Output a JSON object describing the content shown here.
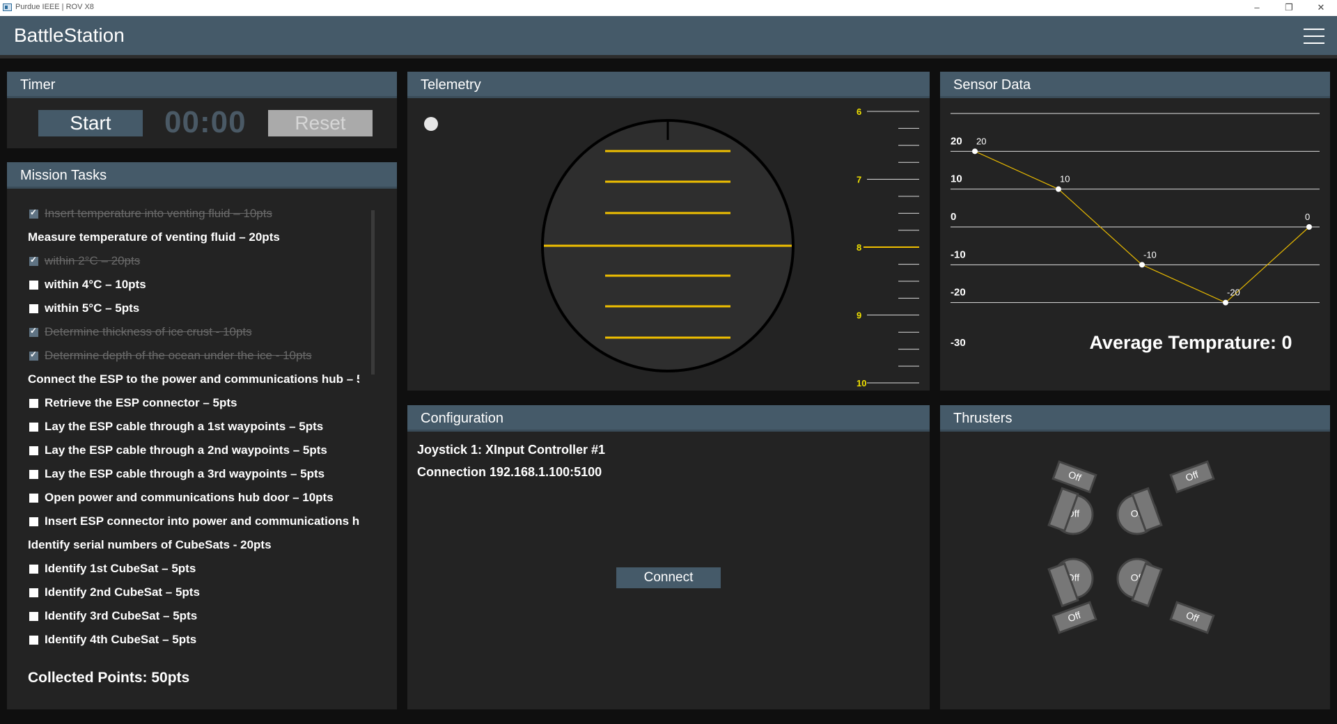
{
  "window": {
    "title": "Purdue IEEE | ROV X8",
    "minimize": "–",
    "restore": "❐",
    "close": "✕"
  },
  "header": {
    "brand": "BattleStation",
    "menu_icon": "hamburger-menu-icon"
  },
  "timer": {
    "title": "Timer",
    "start_label": "Start",
    "time": "00:00",
    "reset_label": "Reset"
  },
  "tasks": {
    "title": "Mission Tasks",
    "items": [
      {
        "label": "Insert temperature into venting fluid – 10pts",
        "type": "task",
        "checked": true
      },
      {
        "label": "Measure temperature of venting fluid – 20pts",
        "type": "heading",
        "checked": false
      },
      {
        "label": "within 2°C – 20pts",
        "type": "task",
        "checked": true
      },
      {
        "label": "within 4°C – 10pts",
        "type": "task",
        "checked": false
      },
      {
        "label": "within 5°C – 5pts",
        "type": "task",
        "checked": false
      },
      {
        "label": "Determine thickness of ice crust - 10pts",
        "type": "task",
        "checked": true
      },
      {
        "label": "Determine depth of the ocean under the ice - 10pts",
        "type": "task",
        "checked": true
      },
      {
        "label": "Connect the ESP to the power and communications hub – 5",
        "type": "heading",
        "checked": false
      },
      {
        "label": "Retrieve the ESP connector – 5pts",
        "type": "task",
        "checked": false
      },
      {
        "label": "Lay the ESP cable through a 1st waypoints  – 5pts",
        "type": "task",
        "checked": false
      },
      {
        "label": "Lay the ESP cable through a 2nd waypoints  – 5pts",
        "type": "task",
        "checked": false
      },
      {
        "label": "Lay the ESP cable through a 3rd waypoints  – 5pts",
        "type": "task",
        "checked": false
      },
      {
        "label": "Open power and communications hub door – 10pts",
        "type": "task",
        "checked": false
      },
      {
        "label": "Insert ESP connector into power and communications hu",
        "type": "task",
        "checked": false
      },
      {
        "label": "Identify serial numbers of CubeSats - 20pts",
        "type": "heading",
        "checked": false
      },
      {
        "label": "Identify 1st CubeSat – 5pts",
        "type": "task",
        "checked": false
      },
      {
        "label": "Identify 2nd CubeSat – 5pts",
        "type": "task",
        "checked": false
      },
      {
        "label": "Identify 3rd CubeSat – 5pts",
        "type": "task",
        "checked": false
      },
      {
        "label": "Identify 4th CubeSat – 5pts",
        "type": "task",
        "checked": false
      }
    ],
    "collected": "Collected Points: 50pts"
  },
  "telemetry": {
    "title": "Telemetry",
    "depth_labels": [
      "6",
      "7",
      "8",
      "9",
      "10"
    ],
    "current_depth": 8,
    "accent": "#f0c000"
  },
  "sensor": {
    "title": "Sensor Data",
    "average_label": "Average Temprature: 0",
    "chart_data": {
      "type": "line",
      "title": "",
      "ylim": [
        -30,
        30
      ],
      "yticks": [
        20,
        10,
        0,
        -10,
        -20,
        -30
      ],
      "x": [
        0,
        1,
        2,
        3,
        4
      ],
      "values": [
        20,
        10,
        -10,
        -20,
        0
      ],
      "point_labels": [
        "20",
        "10",
        "-10",
        "-20",
        "0"
      ],
      "line_color": "#e6b800"
    }
  },
  "config": {
    "title": "Configuration",
    "joystick": "Joystick 1: XInput Controller #1",
    "connection": "Connection 192.168.1.100:5100",
    "connect_label": "Connect"
  },
  "thrusters": {
    "title": "Thrusters",
    "horizontal": [
      "Off",
      "Off",
      "Off",
      "Off"
    ],
    "vertical": [
      "Off",
      "Off",
      "Off",
      "Off"
    ]
  }
}
